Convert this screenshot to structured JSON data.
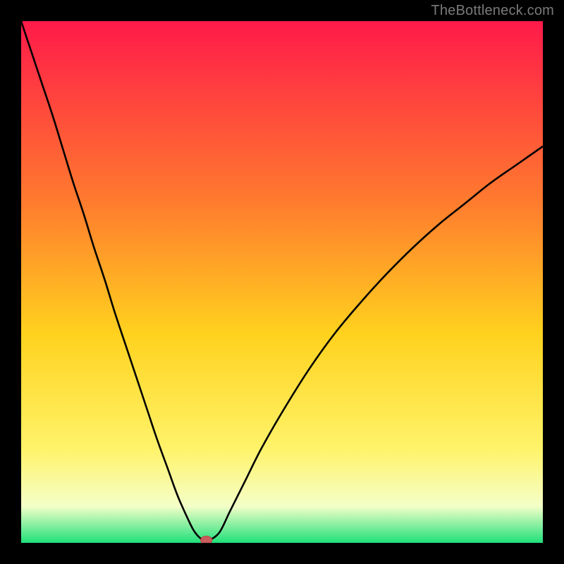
{
  "watermark": "TheBottleneck.com",
  "colors": {
    "gradient_top": "#ff1a49",
    "gradient_mid_upper": "#ff7c2e",
    "gradient_mid": "#ffd21e",
    "gradient_mid_lower": "#fff36a",
    "gradient_lower": "#f4ffc8",
    "gradient_bottom": "#1fe07a",
    "frame": "#000000",
    "curve": "#000000",
    "marker": "#c95d5d"
  },
  "chart_data": {
    "type": "line",
    "title": "",
    "xlabel": "",
    "ylabel": "",
    "xlim": [
      0,
      100
    ],
    "ylim": [
      0,
      100
    ],
    "x": [
      0,
      2,
      4,
      6,
      8,
      10,
      12,
      14,
      16,
      18,
      20,
      22,
      24,
      26,
      28,
      30,
      32,
      33,
      34,
      35,
      36,
      38,
      40,
      43,
      46,
      50,
      55,
      60,
      65,
      70,
      75,
      80,
      85,
      90,
      95,
      100
    ],
    "series": [
      {
        "name": "bottleneck_curve",
        "values": [
          100,
          94,
          88,
          82,
          75.5,
          69,
          63,
          56.5,
          50.5,
          44,
          38,
          32,
          26,
          20,
          14.5,
          9,
          4.5,
          2.5,
          1.2,
          0.5,
          0.5,
          2,
          6,
          12,
          18,
          25,
          33,
          40,
          46,
          51.5,
          56.5,
          61,
          65,
          69,
          72.5,
          76
        ]
      }
    ],
    "marker": {
      "x": 35.5,
      "y": 0.5
    }
  }
}
